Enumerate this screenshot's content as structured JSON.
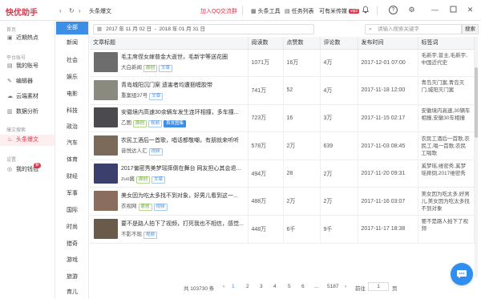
{
  "app": {
    "logo": "快优助手",
    "breadcrumb": "头条爆文",
    "qq_link": "加入QQ交流群",
    "toolbar": [
      {
        "icon": "grid-icon",
        "glyph": "▦",
        "label": "头条工具"
      },
      {
        "icon": "list-icon",
        "glyph": "▤",
        "label": "任务列表"
      },
      {
        "icon": "",
        "glyph": "",
        "label": "可有米传媒",
        "badge": "vip3"
      }
    ],
    "nav_glyphs": {
      "back": "‹",
      "refresh": "↻",
      "forward": "›"
    }
  },
  "sidebar": {
    "sections": [
      {
        "title": "首页",
        "items": [
          {
            "icon": "image-icon",
            "glyph": "▣",
            "label": "近期热点"
          }
        ]
      },
      {
        "title": "平台账号",
        "items": [
          {
            "icon": "file-icon",
            "glyph": "▤",
            "label": "我的账号"
          },
          {
            "icon": "edit-icon",
            "glyph": "✎",
            "label": "编辑器"
          },
          {
            "icon": "cloud-icon",
            "glyph": "☁",
            "label": "云端素材"
          },
          {
            "icon": "chart-icon",
            "glyph": "▥",
            "label": "数据分析"
          }
        ]
      },
      {
        "title": "爆文搜索",
        "items": [
          {
            "icon": "fire-icon",
            "glyph": "♨",
            "label": "头条爆文",
            "active": true
          }
        ]
      },
      {
        "title": "设置",
        "items": [
          {
            "icon": "wallet-icon",
            "glyph": "◎",
            "label": "我的钱包",
            "badge": "新"
          }
        ]
      }
    ]
  },
  "categories": [
    "全部",
    "新闻",
    "社会",
    "娱乐",
    "电影",
    "科技",
    "政治",
    "汽车",
    "体育",
    "财经",
    "军事",
    "国际",
    "时尚",
    "猎奇",
    "游戏",
    "旅游",
    "育儿"
  ],
  "filter": {
    "date_from": "2017 年 11 月 02 日",
    "date_sep": "-",
    "date_to": "2018 年 01 月 31 日",
    "search_placeholder": "请输入搜索关键字",
    "search_button": "搜索"
  },
  "table": {
    "headers": [
      "文章标题",
      "阅读数",
      "点赞数",
      "评论数",
      "发布时间",
      "标签词"
    ],
    "rows": [
      {
        "title": "毛主席侄女嫁普金大逝世，毛新宇等送花圈",
        "source": "大白新闻",
        "tags": [
          "原创",
          "文章"
        ],
        "reads": "1071万",
        "likes": "16万",
        "comments": "4万",
        "time": "2017-12-01 07:00",
        "keywords": "毛新宇,曾主,毛新宇,中国近代史",
        "thumb": "#6d6d6d"
      },
      {
        "title": "青岛城阳沉门案 遗害者均遭捆缠胶带",
        "source": "重案组37号",
        "tags": [
          "文章"
        ],
        "reads": "741万",
        "likes": "52",
        "comments": "4万",
        "time": "2017-11-18 12:00",
        "keywords": "青岛灭门案,青岛灭门,城阳灭门案",
        "thumb": "#8a8a80"
      },
      {
        "title": "安徽境内高速30余辆车发生连环相撞，多车撞...",
        "source": "乙图",
        "tags": [
          "原创",
          "视频",
          "首发图集"
        ],
        "reads": "723万",
        "likes": "16",
        "comments": "3万",
        "time": "2017-11-15 02:17",
        "keywords": "安徽境内高速,30辆车相撞,安徽30车相撞",
        "thumb": "#4a4a4f"
      },
      {
        "title": "农民工酒后一首歌，唱话都敬嘲，有朋就来听听",
        "source": "音悦达人汇",
        "tags": [
          "视频"
        ],
        "reads": "578万",
        "likes": "2万",
        "comments": "639",
        "time": "2017-11-03 08:45",
        "keywords": "农民工酒后一首歌,农民工,唱一首歌,农民工唱歌",
        "thumb": "#7b6a5a"
      },
      {
        "title": "2017偏密秀美梦瑶摔倒在舞台 网友担心其会退...",
        "source": "zuo酱",
        "tags": [
          "原创",
          "文章"
        ],
        "reads": "494万",
        "likes": "28",
        "comments": "2万",
        "time": "2017-11-20 09:31",
        "keywords": "奚梦瑶,维密秀,奚梦瑶摔倒,2017维密秀",
        "thumb": "#3a3f6b"
      },
      {
        "title": "美女因为吃太多找不到对象，好男儿看到这一...",
        "source": "衣视网",
        "tags": [
          "原创",
          "视频"
        ],
        "reads": "488万",
        "likes": "2万",
        "comments": "2万",
        "time": "2017-11-16 03:07",
        "keywords": "美女因为吃太多,好男儿,美女因为吃太多找不到对象",
        "thumb": "#8a6d5d"
      },
      {
        "title": "要不是路人拍下了视频，打死我也不相信，感觉...",
        "source": "不影不现",
        "tags": [
          "视频"
        ],
        "reads": "448万",
        "likes": "6千",
        "comments": "9千",
        "time": "2017-11-17 18:38",
        "keywords": "要不是路人拍下了视频",
        "thumb": "#6a5a4a"
      }
    ]
  },
  "pager": {
    "total": "共 103730 条",
    "prev": "‹",
    "pages": [
      "1",
      "2",
      "3",
      "4",
      "5",
      "6",
      "...",
      "5187"
    ],
    "next": "›",
    "goto_label": "前往",
    "goto_value": "1",
    "goto_suffix": "页"
  },
  "colors": {
    "brand": "#e0344b",
    "accent": "#3d8ee6"
  }
}
